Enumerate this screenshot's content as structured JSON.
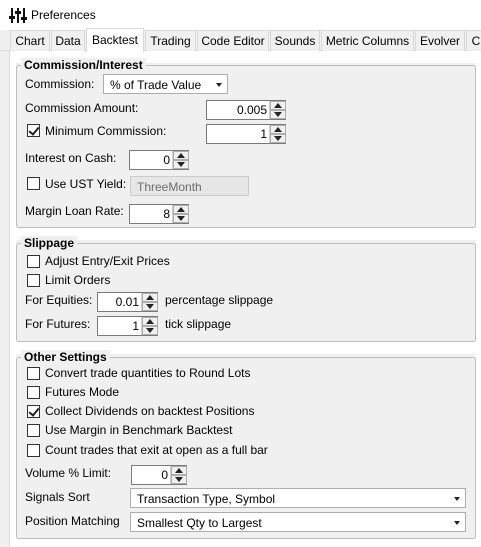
{
  "window": {
    "title": "Preferences",
    "icon": "sliders-icon"
  },
  "tabs": [
    {
      "label": "Chart"
    },
    {
      "label": "Data"
    },
    {
      "label": "Backtest"
    },
    {
      "label": "Trading"
    },
    {
      "label": "Code Editor"
    },
    {
      "label": "Sounds"
    },
    {
      "label": "Metric Columns"
    },
    {
      "label": "Evolver"
    },
    {
      "label": "C"
    }
  ],
  "active_tab": "Backtest",
  "commission": {
    "title": "Commission/Interest",
    "commission_label": "Commission:",
    "commission_value": "% of Trade Value",
    "amount_label": "Commission Amount:",
    "amount_value": "0.005",
    "min_label": "Minimum Commission:",
    "min_checked": true,
    "min_value": "1",
    "interest_label": "Interest on Cash:",
    "interest_value": "0",
    "ust_label": "Use UST Yield:",
    "ust_checked": false,
    "ust_value": "ThreeMonth",
    "margin_label": "Margin Loan Rate:",
    "margin_value": "8"
  },
  "slippage": {
    "title": "Slippage",
    "adjust_label": "Adjust Entry/Exit Prices",
    "adjust_checked": false,
    "limit_label": "Limit Orders",
    "limit_checked": false,
    "equities_label": "For Equities:",
    "equities_value": "0.01",
    "equities_suffix": "percentage slippage",
    "futures_label": "For Futures:",
    "futures_value": "1",
    "futures_suffix": "tick slippage"
  },
  "other": {
    "title": "Other Settings",
    "round_lots_label": "Convert trade quantities to Round Lots",
    "round_lots_checked": false,
    "futures_mode_label": "Futures Mode",
    "futures_mode_checked": false,
    "dividends_label": "Collect Dividends on backtest Positions",
    "dividends_checked": true,
    "benchmark_margin_label": "Use Margin in Benchmark Backtest",
    "benchmark_margin_checked": false,
    "full_bar_label": "Count trades that exit at open as a full bar",
    "full_bar_checked": false,
    "volume_label": "Volume % Limit:",
    "volume_value": "0",
    "signals_sort_label": "Signals Sort",
    "signals_sort_value": "Transaction Type, Symbol",
    "position_matching_label": "Position Matching",
    "position_matching_value": "Smallest Qty to Largest"
  }
}
